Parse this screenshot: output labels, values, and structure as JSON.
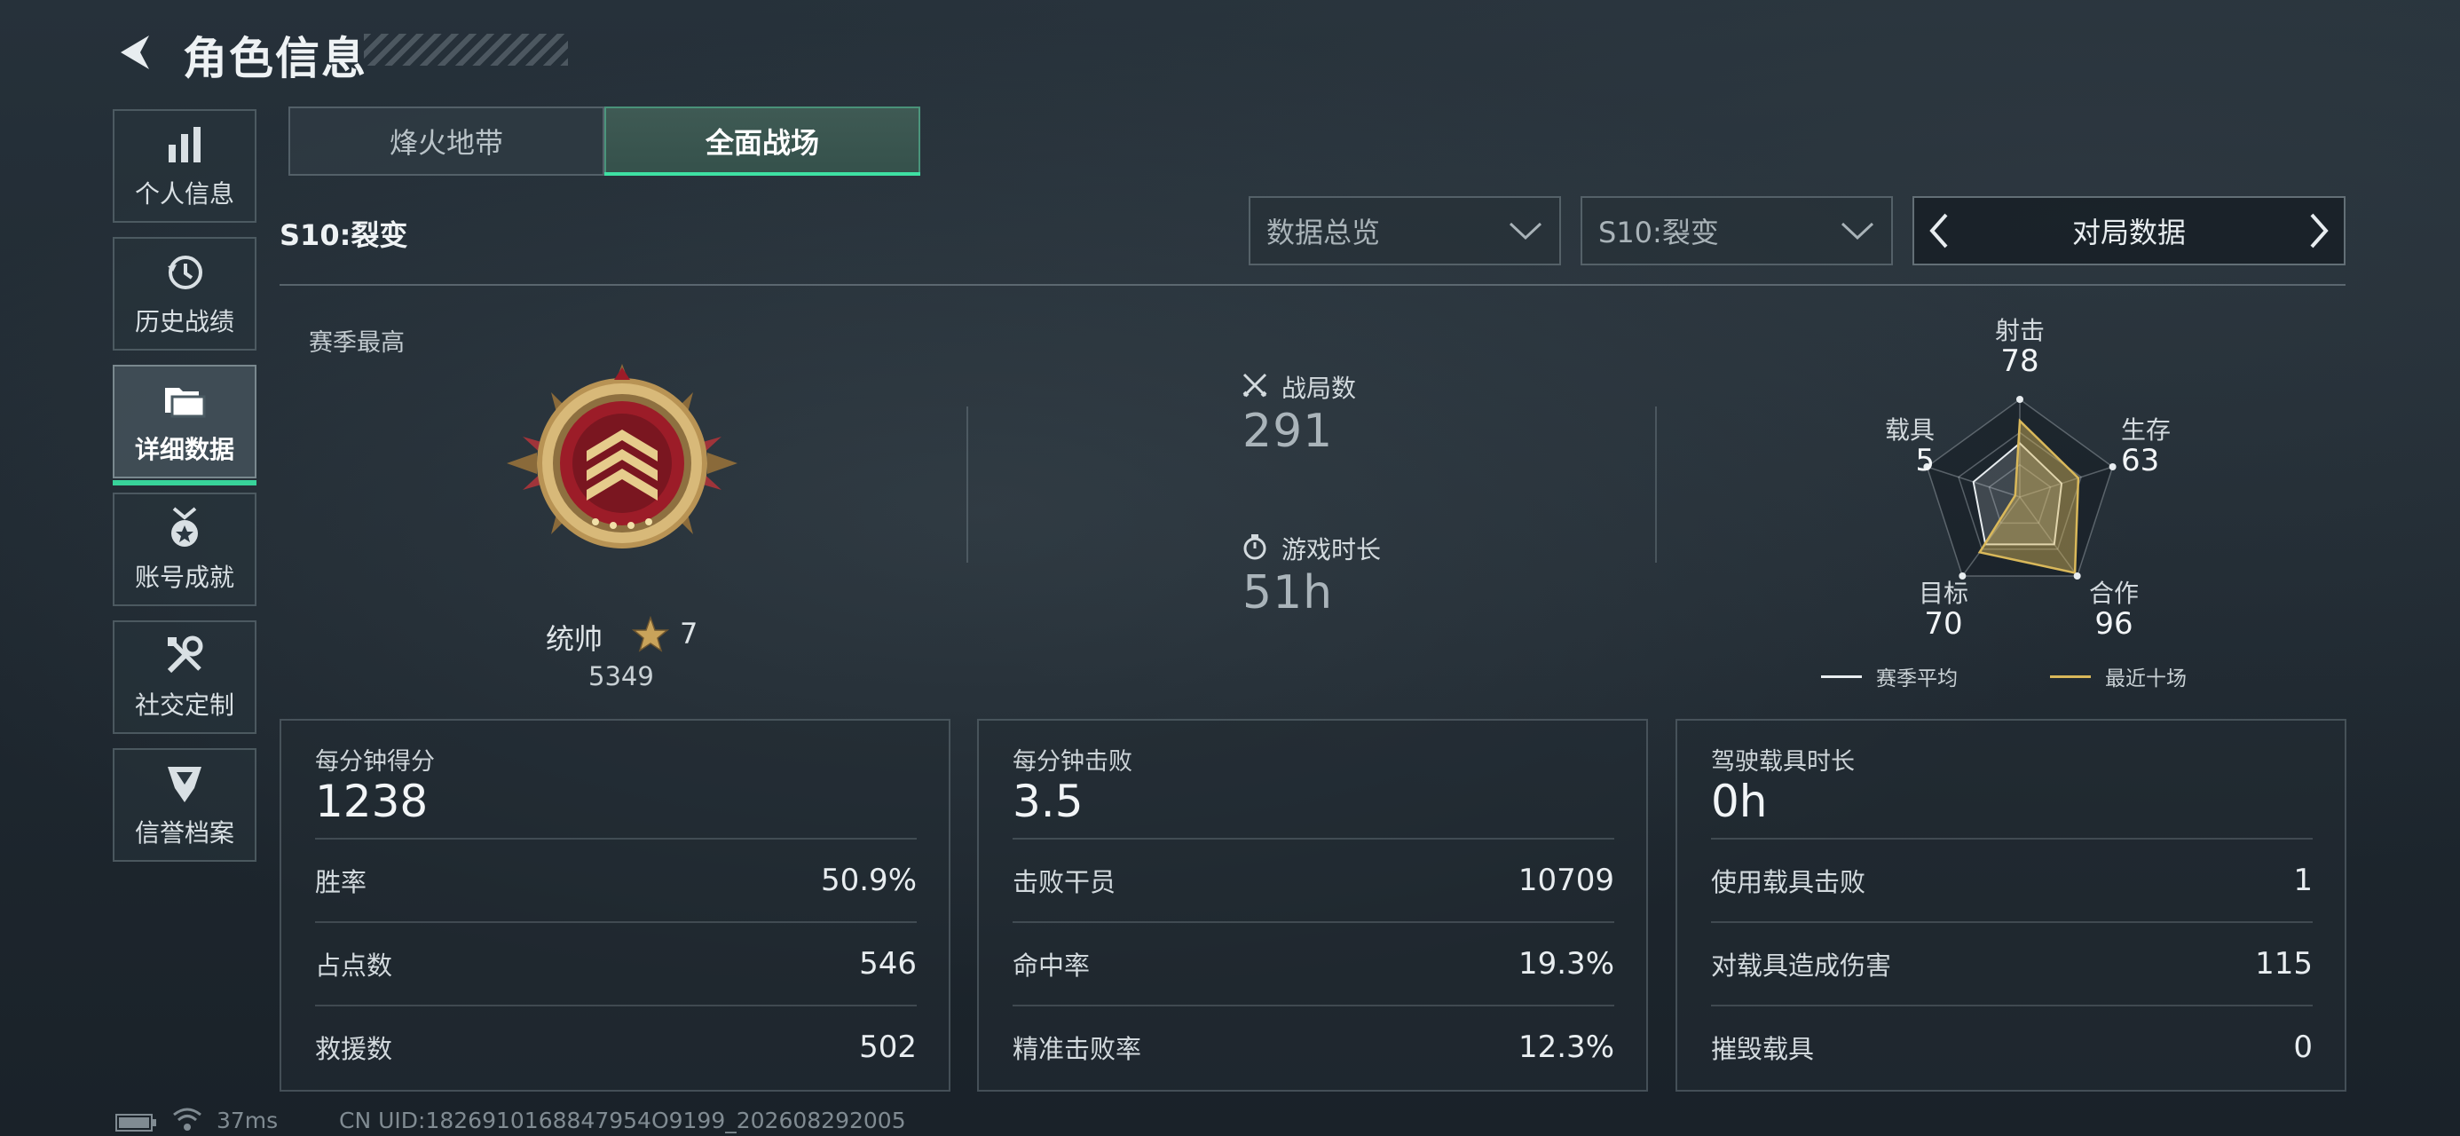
{
  "header": {
    "title": "角色信息"
  },
  "sidebar": {
    "items": [
      {
        "label": "个人信息",
        "icon": "bar-chart-icon"
      },
      {
        "label": "历史战绩",
        "icon": "history-icon"
      },
      {
        "label": "详细数据",
        "icon": "folder-icon",
        "active": true
      },
      {
        "label": "账号成就",
        "icon": "medal-icon"
      },
      {
        "label": "社交定制",
        "icon": "tools-icon"
      },
      {
        "label": "信誉档案",
        "icon": "credit-shield-icon"
      }
    ]
  },
  "tabs": [
    {
      "label": "烽火地带",
      "active": false
    },
    {
      "label": "全面战场",
      "active": true
    }
  ],
  "season_label": "S10:裂变",
  "filters": {
    "overview": "数据总览",
    "season": "S10:裂变",
    "category": "对局数据"
  },
  "season_best": {
    "title": "赛季最高",
    "rank_name": "统帅",
    "rank_level": "7",
    "score": "5349"
  },
  "summary": {
    "matches_label": "战局数",
    "matches_value": "291",
    "playtime_label": "游戏时长",
    "playtime_value": "51h"
  },
  "radar": {
    "axes": [
      {
        "label": "射击",
        "value": "78"
      },
      {
        "label": "生存",
        "value": "63"
      },
      {
        "label": "合作",
        "value": "96"
      },
      {
        "label": "目标",
        "value": "70"
      },
      {
        "label": "载具",
        "value": "5"
      }
    ],
    "season_avg": [
      0.55,
      0.45,
      0.6,
      0.6,
      0.5
    ],
    "recent_ten": [
      0.78,
      0.63,
      0.96,
      0.7,
      0.05
    ],
    "legend_avg": "赛季平均",
    "legend_recent": "最近十场",
    "color_avg": "#e8edf0",
    "color_recent": "#d9b85a"
  },
  "panels": [
    {
      "title": "每分钟得分",
      "value": "1238",
      "rows": [
        {
          "label": "胜率",
          "value": "50.9%"
        },
        {
          "label": "占点数",
          "value": "546"
        },
        {
          "label": "救援数",
          "value": "502"
        }
      ]
    },
    {
      "title": "每分钟击败",
      "value": "3.5",
      "rows": [
        {
          "label": "击败干员",
          "value": "10709"
        },
        {
          "label": "命中率",
          "value": "19.3%"
        },
        {
          "label": "精准击败率",
          "value": "12.3%"
        }
      ]
    },
    {
      "title": "驾驶载具时长",
      "value": "0h",
      "rows": [
        {
          "label": "使用载具击败",
          "value": "1"
        },
        {
          "label": "对载具造成伤害",
          "value": "115"
        },
        {
          "label": "摧毁载具",
          "value": "0"
        }
      ]
    }
  ],
  "footer": {
    "ping": "37ms",
    "uid": "CN UID:1826910168847954O9199_202608292005"
  },
  "colors": {
    "accent": "#3ee0a3"
  }
}
